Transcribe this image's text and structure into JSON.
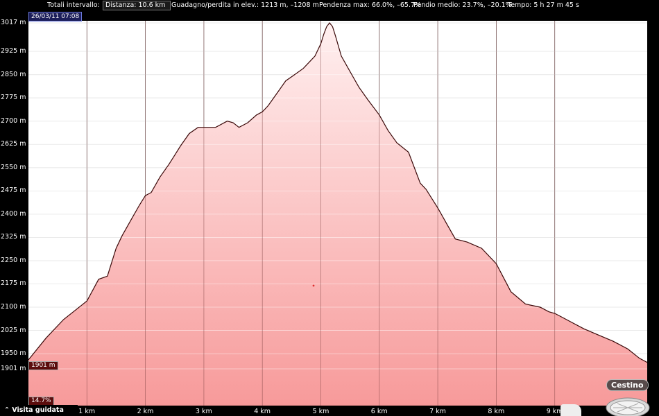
{
  "topbar": {
    "range_label": "Totali intervallo:",
    "distance": "Distanza: 10.6 km",
    "gain_loss": "Guadagno/perdita in elev.: 1213 m, –1208 m",
    "slope_max": "Pendenza max: 66.0%, –65.7%",
    "slope_avg": "Pendio medio: 23.7%, –20.1%",
    "time": "Tempo: 5 h 27 m 45 s"
  },
  "date": "26/03/11 07:08",
  "y_axis_labels": [
    "3017 m",
    "2925 m",
    "2850 m",
    "2775 m",
    "2700 m",
    "2625 m",
    "2550 m",
    "2475 m",
    "2400 m",
    "2325 m",
    "2250 m",
    "2175 m",
    "2100 m",
    "2025 m",
    "1950 m",
    "1901 m"
  ],
  "x_axis_labels": [
    "1 km",
    "2 km",
    "3 km",
    "4 km",
    "5 km",
    "6 km",
    "7 km",
    "8 km",
    "9 km"
  ],
  "cursor_elevation_tag": "1901 m",
  "cursor_slope_tag": "14.7%",
  "guided_tour_label": "Visita guidata",
  "trash_label": "Cestino",
  "colors": {
    "profile_fill_top": "#fff0f0",
    "profile_fill_bottom": "#f79a9a",
    "grid": "#d0d0d0",
    "tag": "#5b0d0d",
    "date_box": "#1c1e5a"
  },
  "chart_data": {
    "type": "area",
    "xlabel": "",
    "ylabel": "",
    "ylim": [
      1901,
      3017
    ],
    "xlim": [
      0,
      10.6
    ],
    "grid": true,
    "x": [
      0,
      0.3,
      0.6,
      0.9,
      1.0,
      1.2,
      1.35,
      1.5,
      1.6,
      1.75,
      1.9,
      2.0,
      2.1,
      2.25,
      2.4,
      2.5,
      2.6,
      2.75,
      2.9,
      3.0,
      3.2,
      3.4,
      3.5,
      3.6,
      3.75,
      3.9,
      4.0,
      4.1,
      4.25,
      4.4,
      4.55,
      4.7,
      4.8,
      4.9,
      5.0,
      5.05,
      5.1,
      5.15,
      5.2,
      5.25,
      5.35,
      5.5,
      5.65,
      5.8,
      6.0,
      6.15,
      6.3,
      6.5,
      6.7,
      6.8,
      7.0,
      7.15,
      7.3,
      7.5,
      7.75,
      8.0,
      8.25,
      8.5,
      8.75,
      8.9,
      9.0,
      9.1,
      9.3,
      9.5,
      9.75,
      10.0,
      10.25,
      10.45,
      10.6
    ],
    "y": [
      1930,
      2000,
      2060,
      2105,
      2120,
      2190,
      2200,
      2290,
      2330,
      2380,
      2430,
      2460,
      2470,
      2520,
      2560,
      2590,
      2620,
      2660,
      2680,
      2680,
      2680,
      2700,
      2695,
      2680,
      2695,
      2720,
      2730,
      2750,
      2790,
      2830,
      2850,
      2870,
      2890,
      2910,
      2950,
      2980,
      3005,
      3017,
      3005,
      2975,
      2910,
      2860,
      2810,
      2770,
      2720,
      2670,
      2630,
      2600,
      2500,
      2480,
      2420,
      2370,
      2320,
      2310,
      2290,
      2240,
      2150,
      2110,
      2100,
      2085,
      2080,
      2070,
      2050,
      2030,
      2010,
      1990,
      1965,
      1935,
      1920
    ]
  }
}
